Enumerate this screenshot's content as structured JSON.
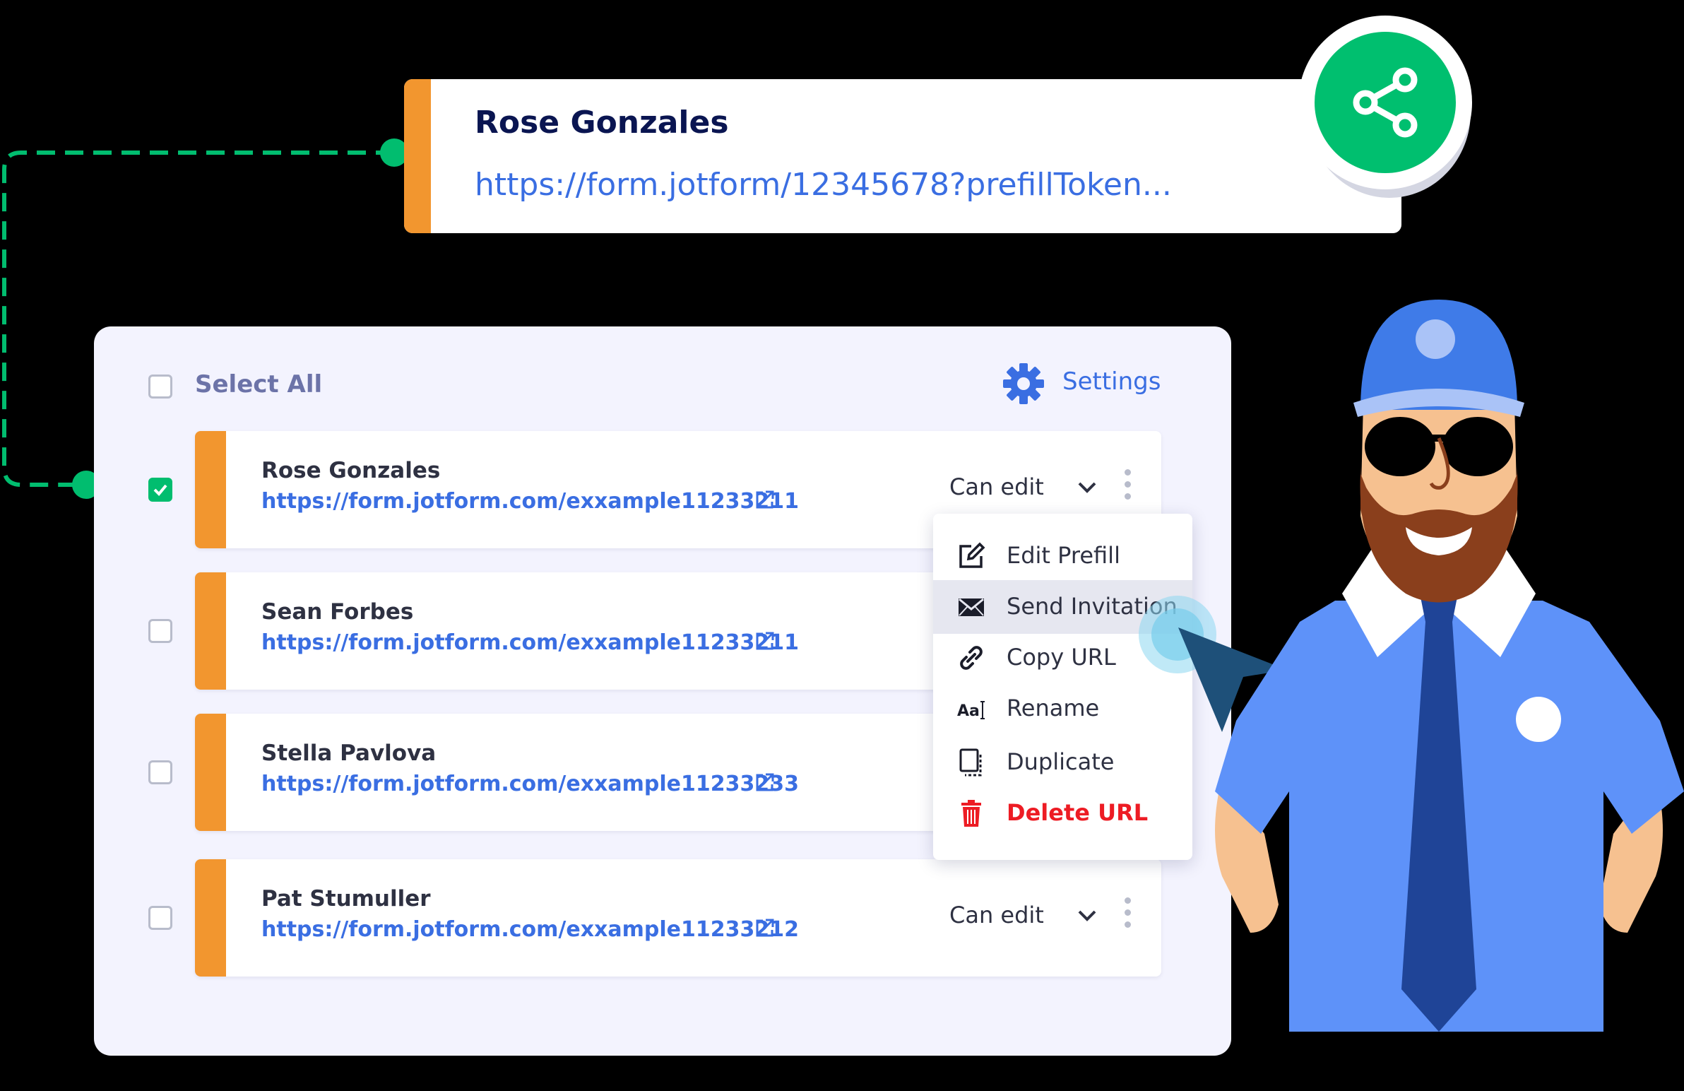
{
  "colors": {
    "accent_orange": "#f2962f",
    "share_green": "#00bf6f",
    "connector_green": "#01bd6f",
    "link_blue": "#3a6ee2",
    "danger_red": "#ed1c24",
    "panel_bg": "#f3f3fe"
  },
  "shared_link": {
    "name": "Rose Gonzales",
    "url": "https://form.jotform/12345678?prefillToken...",
    "share_icon": "share-icon"
  },
  "list": {
    "select_all_label": "Select All",
    "settings_label": "Settings",
    "settings_icon": "gear-icon",
    "rows": [
      {
        "name": "Rose Gonzales",
        "url": "https://form.jotform.com/exxample11233211",
        "checked": true,
        "permission": "Can edit"
      },
      {
        "name": "Sean Forbes",
        "url": "https://form.jotform.com/exxample11233211",
        "checked": false
      },
      {
        "name": "Stella Pavlova",
        "url": "https://form.jotform.com/exxample11233233",
        "checked": false
      },
      {
        "name": "Pat Stumuller",
        "url": "https://form.jotform.com/exxample11233212",
        "checked": false,
        "permission": "Can edit"
      }
    ]
  },
  "menu": {
    "items": [
      {
        "label": "Edit Prefill",
        "icon": "edit-icon"
      },
      {
        "label": "Send Invitation",
        "icon": "envelope-icon",
        "highlighted": true
      },
      {
        "label": "Copy URL",
        "icon": "link-icon"
      },
      {
        "label": "Rename",
        "icon": "rename-icon"
      },
      {
        "label": "Duplicate",
        "icon": "duplicate-icon"
      },
      {
        "label": "Delete URL",
        "icon": "trash-icon",
        "danger": true
      }
    ]
  }
}
